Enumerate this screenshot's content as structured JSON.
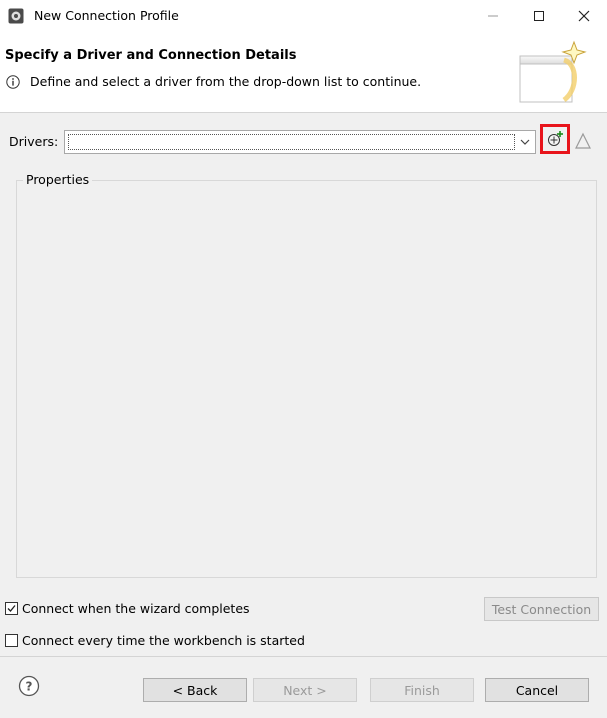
{
  "window": {
    "title": "New Connection Profile"
  },
  "header": {
    "title": "Specify a Driver and Connection Details",
    "message": "Define and select a driver from the drop-down list to continue."
  },
  "drivers": {
    "label": "Drivers:",
    "value": ""
  },
  "properties": {
    "label": "Properties"
  },
  "options": {
    "connect_on_finish": {
      "label": "Connect when the wizard completes",
      "checked": true
    },
    "connect_on_startup": {
      "label": "Connect every time the workbench is started",
      "checked": false
    }
  },
  "buttons": {
    "test_connection": "Test Connection",
    "back": "< Back",
    "next": "Next >",
    "finish": "Finish",
    "cancel": "Cancel"
  },
  "colors": {
    "highlight": "#e8141b"
  },
  "icons": [
    "app-icon",
    "info-icon",
    "wizard-banner-icon",
    "new-driver-icon",
    "edit-driver-icon",
    "help-icon"
  ]
}
